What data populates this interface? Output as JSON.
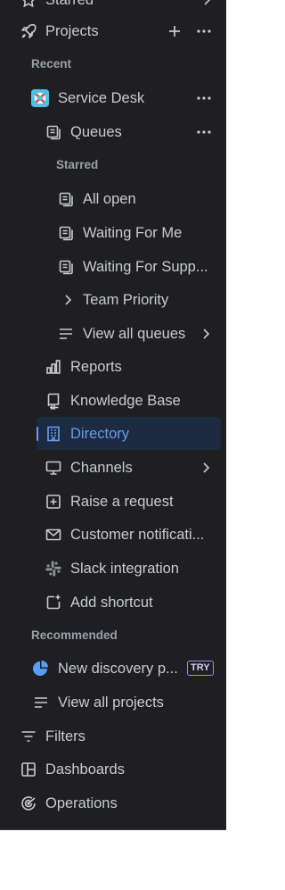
{
  "sidebar": {
    "starred_label": "Starred",
    "projects_label": "Projects",
    "recent_label": "Recent",
    "project": {
      "name": "Service Desk",
      "queues_label": "Queues",
      "starred_label": "Starred",
      "starred_queues": [
        "All open",
        "Waiting For Me",
        "Waiting For Supp..."
      ],
      "team_priority_label": "Team Priority",
      "view_all_queues_label": "View all queues",
      "items": {
        "reports": "Reports",
        "knowledge_base": "Knowledge Base",
        "directory": "Directory",
        "channels": "Channels",
        "raise_request": "Raise a request",
        "customer_notifications": "Customer notificati...",
        "slack_integration": "Slack integration",
        "add_shortcut": "Add shortcut"
      }
    },
    "recommended_label": "Recommended",
    "recommended_item": {
      "name": "New discovery p...",
      "badge": "TRY"
    },
    "view_all_projects_label": "View all projects",
    "filters_label": "Filters",
    "dashboards_label": "Dashboards",
    "operations_label": "Operations"
  },
  "colors": {
    "background": "#1f1f21",
    "text": "#c7cbd1",
    "section_text": "#9aa0a8",
    "selected_bg": "#1c2b41",
    "selected_text": "#669df1",
    "badge_border": "#a28ae6"
  }
}
